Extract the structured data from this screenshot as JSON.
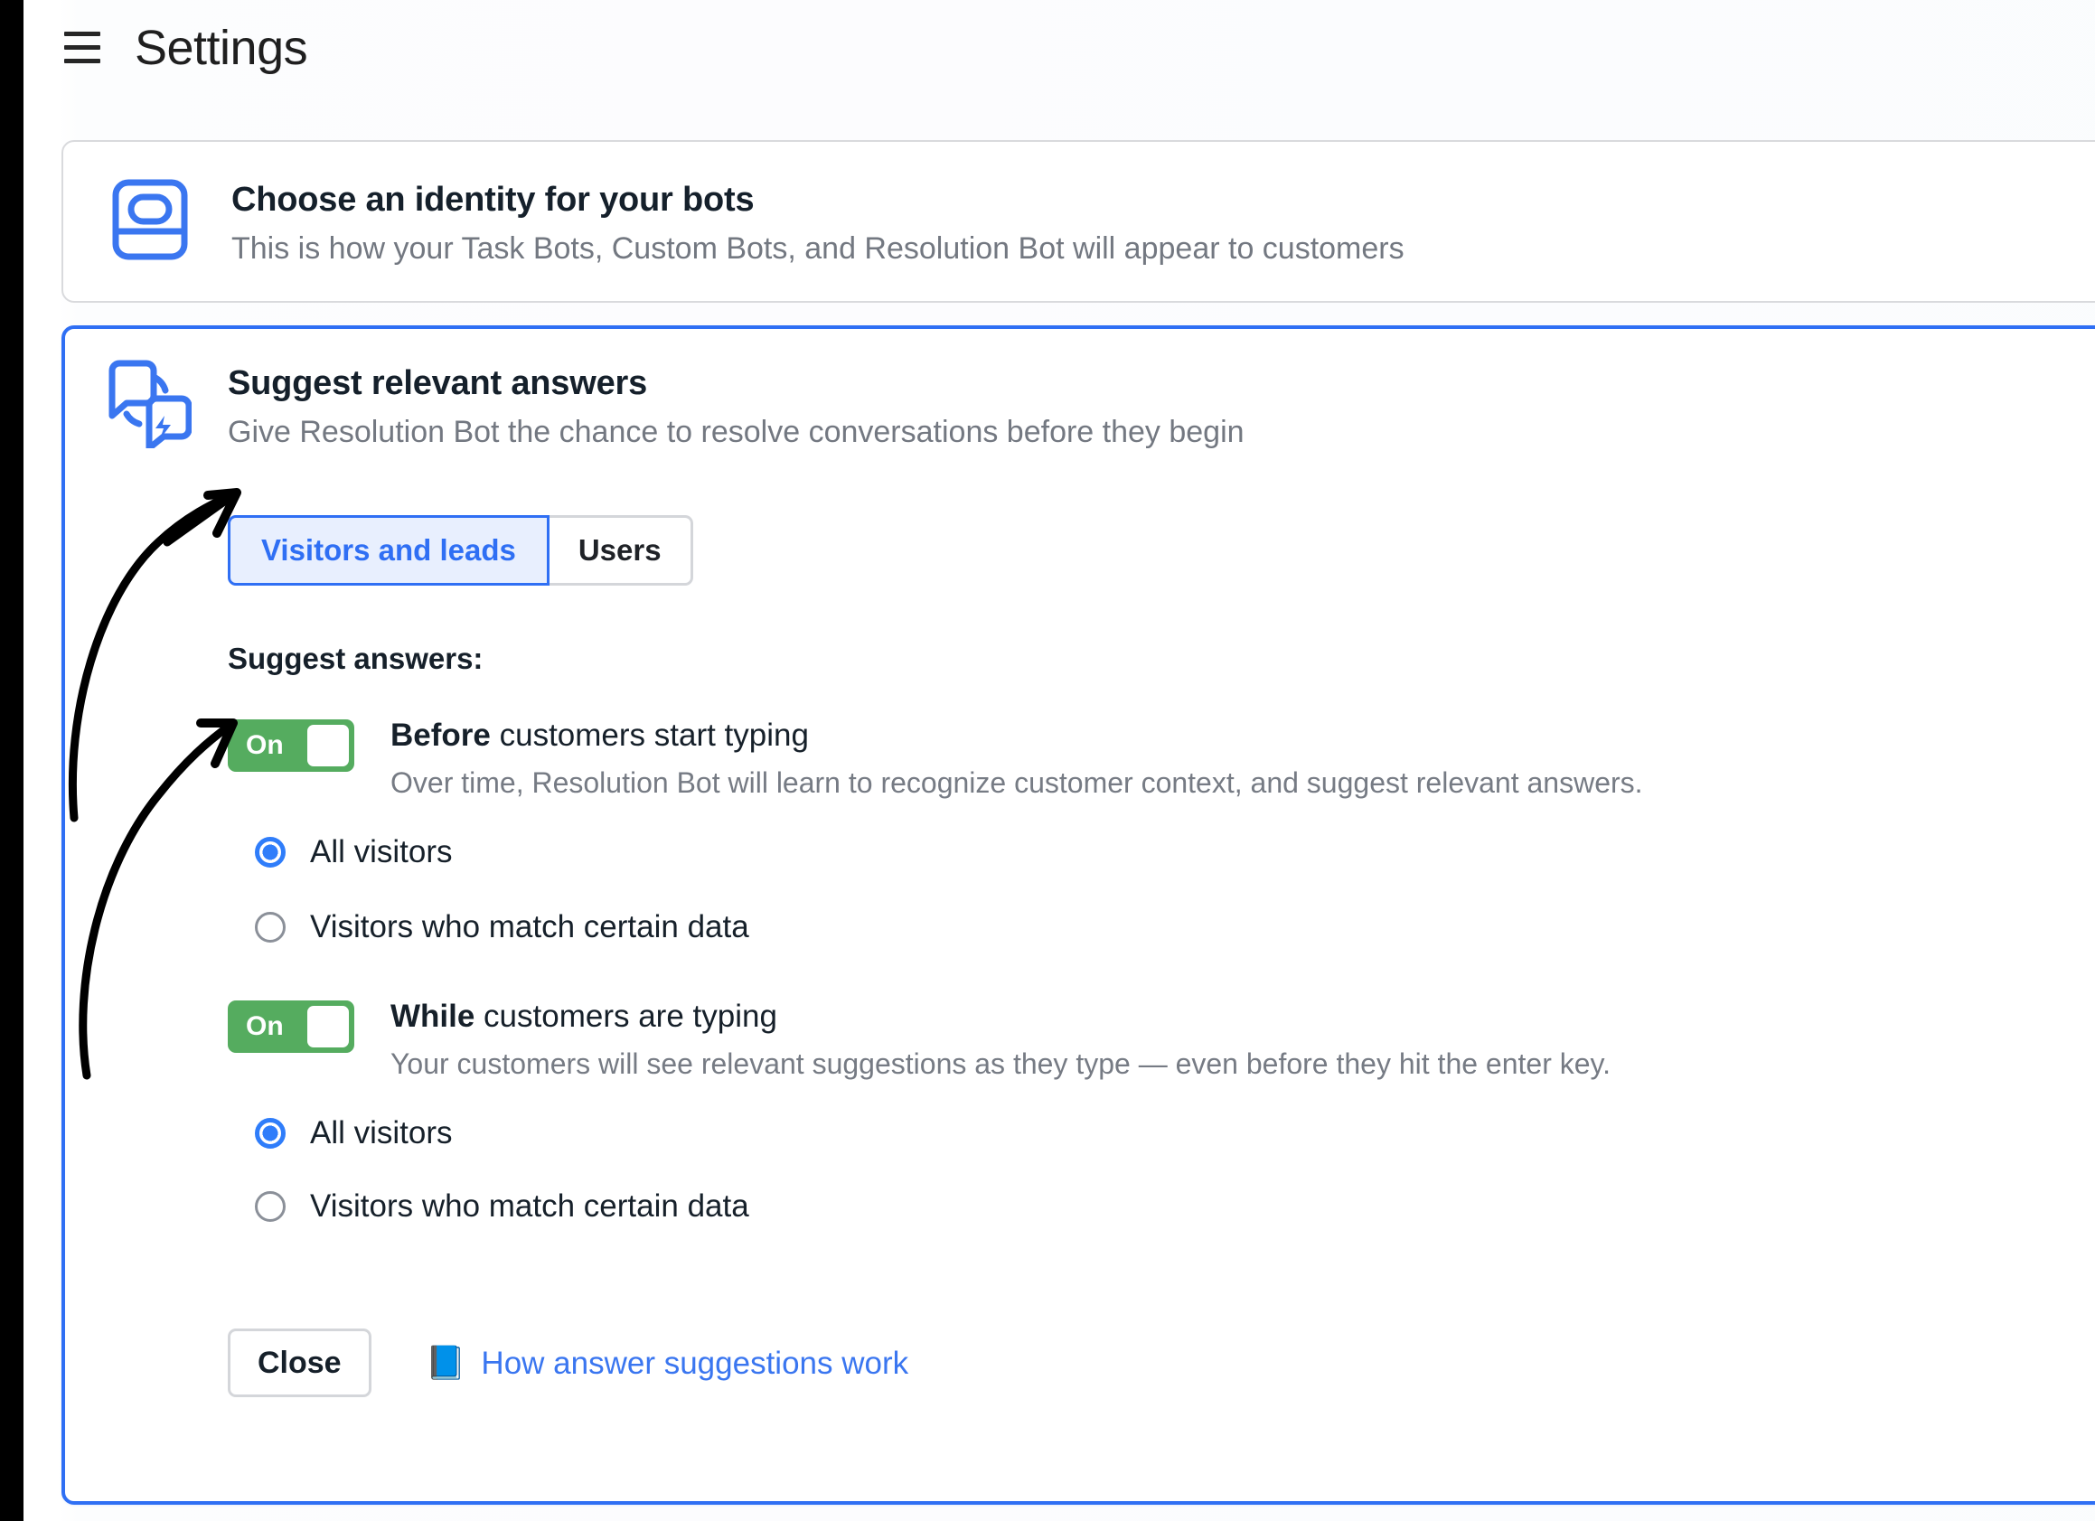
{
  "header": {
    "menu_icon": "hamburger-icon",
    "title": "Settings"
  },
  "cards": {
    "identity": {
      "icon": "bot-identity-card-icon",
      "title": "Choose an identity for your bots",
      "subtitle": "This is how your Task Bots, Custom Bots, and Resolution Bot will appear to customers"
    },
    "suggest": {
      "icon": "chat-bubbles-lightning-icon",
      "title": "Suggest relevant answers",
      "subtitle": "Give Resolution Bot the chance to resolve conversations before they begin",
      "tabs": [
        {
          "label": "Visitors and leads",
          "selected": true
        },
        {
          "label": "Users",
          "selected": false
        }
      ],
      "section_label": "Suggest answers:",
      "settings": [
        {
          "toggle_state": "On",
          "title_strong": "Before",
          "title_rest": " customers start typing",
          "description": "Over time, Resolution Bot will learn to recognize customer context, and suggest relevant answers.",
          "options": [
            {
              "label": "All visitors",
              "selected": true
            },
            {
              "label": "Visitors who match certain data",
              "selected": false
            }
          ]
        },
        {
          "toggle_state": "On",
          "title_strong": "While",
          "title_rest": " customers are typing",
          "description": "Your customers will see relevant suggestions as they type — even before they hit the enter key.",
          "options": [
            {
              "label": "All visitors",
              "selected": true
            },
            {
              "label": "Visitors who match certain data",
              "selected": false
            }
          ]
        }
      ],
      "footer": {
        "close_label": "Close",
        "help_icon": "book-icon",
        "help_glyph": "📘",
        "help_label": "How answer suggestions work"
      }
    }
  },
  "annotations": [
    {
      "name": "arrow-to-visitors-tab",
      "target": "Visitors and leads tab"
    },
    {
      "name": "arrow-to-before-toggle",
      "target": "Before customers start typing toggle"
    }
  ],
  "colors": {
    "accent_blue": "#2f6ff4",
    "link_blue": "#3a76f0",
    "tab_active_bg": "#e8effe",
    "toggle_green": "#55ac5f",
    "radio_blue": "#2f7dfa",
    "text_dark": "#16202a",
    "text_muted": "#767b84",
    "border_gray": "#d4d6da",
    "annotation_black": "#000000"
  }
}
